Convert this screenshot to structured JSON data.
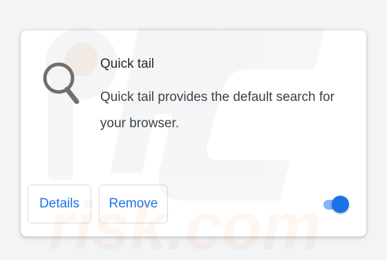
{
  "extension": {
    "name": "Quick tail",
    "description": "Quick tail provides the default search for your browser.",
    "icon": "search-icon",
    "enabled": true
  },
  "buttons": {
    "details_label": "Details",
    "remove_label": "Remove"
  },
  "colors": {
    "accent": "#1a73e8",
    "toggle_track": "#8ab4f8",
    "card_background": "#ffffff",
    "icon_gray": "#6f6f6f"
  },
  "watermark": {
    "text": "PC risk.com"
  }
}
